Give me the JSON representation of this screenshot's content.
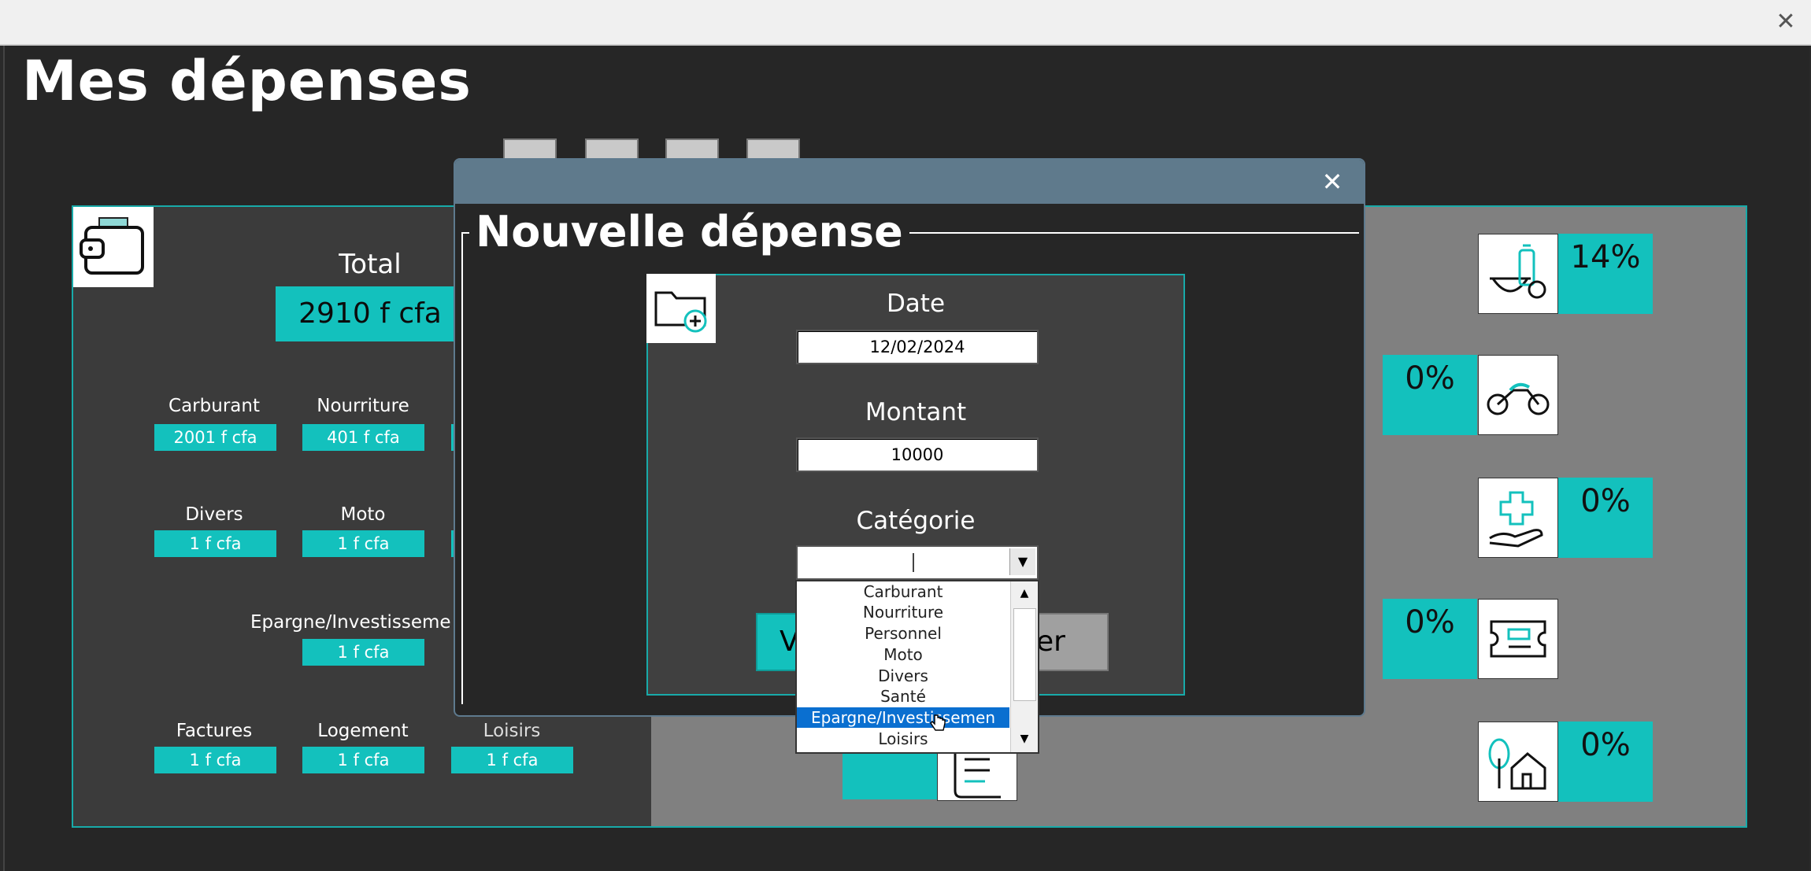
{
  "window": {
    "close_glyph": "✕"
  },
  "app": {
    "title": "Mes dépenses"
  },
  "summary": {
    "total_label": "Total",
    "total_value": "2910 f cfa",
    "categories": [
      {
        "label": "Carburant",
        "value": "2001 f cfa"
      },
      {
        "label": "Nourriture",
        "value": "401 f cfa"
      },
      {
        "label": "Divers",
        "value": "1 f cfa"
      },
      {
        "label": "Moto",
        "value": "1 f cfa"
      },
      {
        "label": "Epargne/Investisseme",
        "value": "1 f cfa"
      },
      {
        "label": "Factures",
        "value": "1 f cfa"
      },
      {
        "label": "Logement",
        "value": "1 f cfa"
      },
      {
        "label": "Loisirs",
        "value": "1 f cfa"
      }
    ]
  },
  "percentages": [
    {
      "icon": "food-icon",
      "value": "14%"
    },
    {
      "icon": "moto-icon",
      "value": "0%"
    },
    {
      "icon": "health-icon",
      "value": "0%"
    },
    {
      "icon": "ticket-icon",
      "value": "0%"
    },
    {
      "icon": "house-icon",
      "value": "0%"
    }
  ],
  "dialog": {
    "title": "Nouvelle dépense",
    "close_glyph": "✕",
    "date_label": "Date",
    "date_value": "12/02/2024",
    "amount_label": "Montant",
    "amount_value": "10000",
    "category_label": "Catégorie",
    "category_value": "",
    "validate_label_partial": "V",
    "cancel_label_partial": "er",
    "dropdown_arrow": "▼",
    "options": [
      "Carburant",
      "Nourriture",
      "Personnel",
      "Moto",
      "Divers",
      "Santé",
      "Epargne/Investissemen",
      "Loisirs"
    ],
    "selected_option": "Epargne/Investissemen",
    "scroll_up": "▲",
    "scroll_down": "▼"
  },
  "colors": {
    "accent": "#13c1bd",
    "dialog_bar": "#5f7a8c",
    "selection": "#0a6fd0"
  }
}
